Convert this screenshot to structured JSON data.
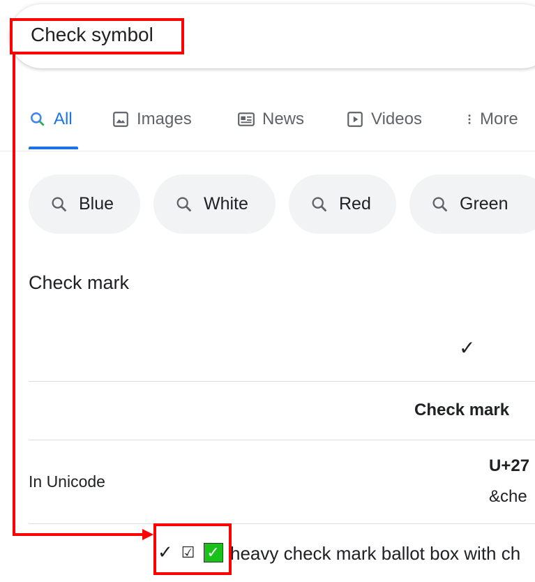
{
  "search": {
    "query": "Check symbol"
  },
  "tabs": [
    {
      "label": "All",
      "icon": "search-icon"
    },
    {
      "label": "Images",
      "icon": "image-icon"
    },
    {
      "label": "News",
      "icon": "news-icon"
    },
    {
      "label": "Videos",
      "icon": "play-icon"
    },
    {
      "label": "More",
      "icon": "more-vert-icon"
    }
  ],
  "chips": [
    {
      "label": "Blue"
    },
    {
      "label": "White"
    },
    {
      "label": "Red"
    },
    {
      "label": "Green"
    }
  ],
  "card": {
    "title": "Check mark",
    "symbol": "✓",
    "column_header": "Check mark",
    "row_label": "In Unicode",
    "code": "U+27",
    "entity": "&che"
  },
  "annotation": {
    "symbols": [
      "✓",
      "☑",
      "✓"
    ],
    "text": "heavy check mark ballot box with ch",
    "color": "#ff0000"
  },
  "colors": {
    "accent": "#1a73e8",
    "highlight": "#ff0000",
    "green_box": "#19c219"
  }
}
